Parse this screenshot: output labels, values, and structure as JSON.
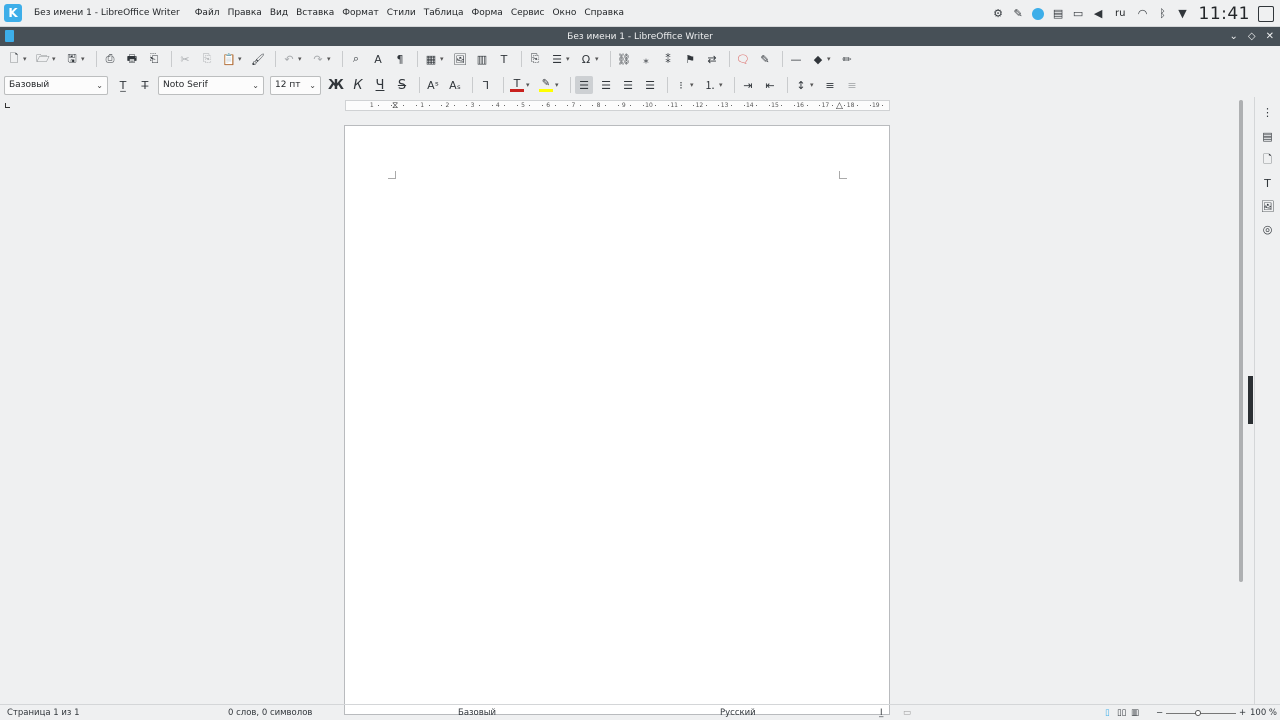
{
  "topbar": {
    "app_title": "Без имени 1 - LibreOffice Writer",
    "menu": [
      "Файл",
      "Правка",
      "Вид",
      "Вставка",
      "Формат",
      "Стили",
      "Таблица",
      "Форма",
      "Сервис",
      "Окно",
      "Справка"
    ],
    "tray_icons": [
      "updates-icon",
      "brush-icon",
      "network-icon",
      "clipboard-icon",
      "battery-icon",
      "volume-icon"
    ],
    "language": "ru",
    "clock": "11:41"
  },
  "window": {
    "title": "Без имени 1 - LibreOffice Writer"
  },
  "formatting": {
    "paragraph_style": "Базовый",
    "font_name": "Noto Serif",
    "font_size": "12 пт",
    "bold_label": "Ж",
    "italic_label": "К",
    "underline_label": "Ч",
    "strike_label": "S",
    "font_color": "#c9211e",
    "highlight_color": "#ffff00"
  },
  "ruler": {
    "left_labels": [
      "1"
    ],
    "labels": [
      "1",
      "2",
      "3",
      "4",
      "5",
      "6",
      "7",
      "8",
      "9",
      "10",
      "11",
      "12",
      "13",
      "14",
      "15",
      "16",
      "17",
      "18",
      "19"
    ]
  },
  "statusbar": {
    "page": "Страница 1 из 1",
    "words": "0 слов, 0 символов",
    "style": "Базовый",
    "language": "Русский",
    "zoom": "100 %"
  },
  "colors": {
    "accent": "#3daee9",
    "titlebar": "#475057"
  }
}
